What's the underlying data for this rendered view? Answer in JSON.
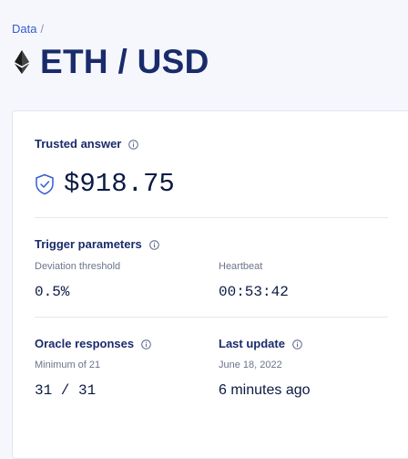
{
  "breadcrumb": {
    "parent": "Data",
    "separator": "/"
  },
  "header": {
    "title": "ETH / USD",
    "icon": "ethereum-icon"
  },
  "trusted_answer": {
    "label": "Trusted answer",
    "value": "$918.75"
  },
  "trigger_parameters": {
    "label": "Trigger parameters",
    "deviation_label": "Deviation threshold",
    "deviation_value": "0.5%",
    "heartbeat_label": "Heartbeat",
    "heartbeat_value": "00:53:42"
  },
  "oracle_responses": {
    "label": "Oracle responses",
    "minimum_label": "Minimum of 21",
    "value": "31 / 31"
  },
  "last_update": {
    "label": "Last update",
    "date": "June 18, 2022",
    "relative": "6 minutes ago"
  },
  "colors": {
    "accent": "#375bd2",
    "title": "#1a2b6b",
    "text": "#0c1a44",
    "background": "#f5f7fd"
  }
}
